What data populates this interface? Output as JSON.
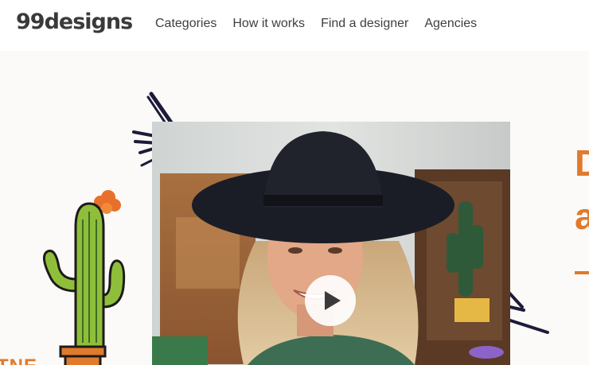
{
  "header": {
    "logo_text": "99designs",
    "nav": [
      {
        "label": "Categories"
      },
      {
        "label": "How it works"
      },
      {
        "label": "Find a designer"
      },
      {
        "label": "Agencies"
      }
    ]
  },
  "hero": {
    "headline_fragments": [
      "D",
      "a"
    ],
    "corner_text": "TNE",
    "video": {
      "play_icon": "play-icon"
    }
  },
  "colors": {
    "accent": "#e07a2c",
    "text": "#3f3f3f",
    "background": "#fbfaf8"
  }
}
